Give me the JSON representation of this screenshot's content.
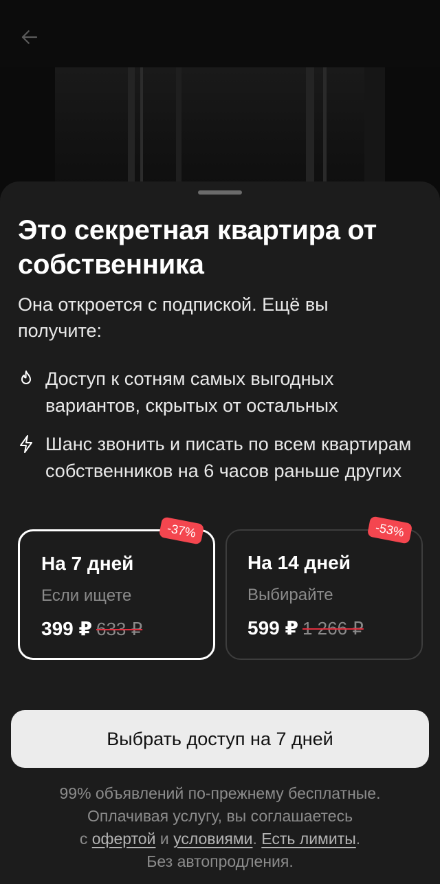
{
  "header": {
    "back_icon": "arrow-left-icon"
  },
  "sheet": {
    "title": "Это секретная квартира от собственника",
    "subtitle": "Она откроется с подпиской. Ещё вы получите:",
    "features": [
      {
        "icon": "flame-icon",
        "text": "Доступ к сотням самых выгодных вариантов, скрытых от остальных"
      },
      {
        "icon": "lightning-icon",
        "text": "Шанс звонить и писать по всем квартирам собственников на 6 часов раньше других"
      }
    ],
    "plans": [
      {
        "name": "На 7 дней",
        "description": "Если ищете",
        "price": "399 ₽",
        "old_price": "633 ₽",
        "discount": "-37%",
        "selected": true
      },
      {
        "name": "На 14 дней",
        "description": "Выбирайте",
        "price": "599 ₽",
        "old_price": "1 266 ₽",
        "discount": "-53%",
        "selected": false
      }
    ],
    "cta_label": "Выбрать доступ на 7 дней",
    "footer": {
      "line1": "99% объявлений по-прежнему бесплатные.",
      "line2": "Оплачивая услугу, вы соглашаетесь",
      "prefix": "с",
      "offer_link": "офертой",
      "conjunction": "и",
      "terms_link": "условиями",
      "dot": ".",
      "limits_link": "Есть лимиты",
      "dot2": ".",
      "line4": "Без автопродления."
    }
  },
  "colors": {
    "sheet_bg": "#1c1c1c",
    "badge": "#f4464f",
    "cta_bg": "#ececec",
    "muted_text": "#8a8a8a"
  }
}
